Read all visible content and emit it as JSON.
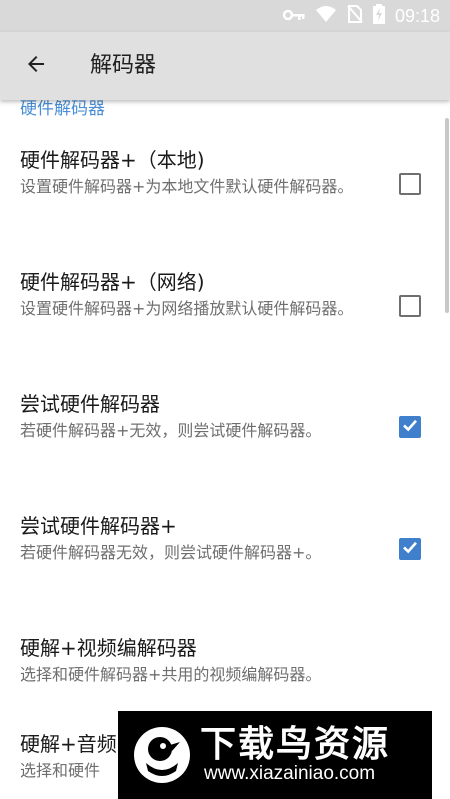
{
  "status_bar": {
    "time": "09:18",
    "icons": [
      "key-icon",
      "wifi-icon",
      "no-sim-icon",
      "battery-charging-icon"
    ]
  },
  "toolbar": {
    "back_icon": "arrow-left-icon",
    "title": "解码器"
  },
  "section": {
    "header": "硬件解码器"
  },
  "preferences": [
    {
      "title": "硬件解码器+（本地)",
      "summary": "设置硬件解码器+为本地文件默认硬件解码器。",
      "checked": false
    },
    {
      "title": "硬件解码器+（网络)",
      "summary": "设置硬件解码器+为网络播放默认硬件解码器。",
      "checked": false
    },
    {
      "title": "尝试硬件解码器",
      "summary": "若硬件解码器+无效，则尝试硬件解码器。",
      "checked": true
    },
    {
      "title": "尝试硬件解码器+",
      "summary": "若硬件解码器无效，则尝试硬件解码器+。",
      "checked": true
    },
    {
      "title": "硬解+视频编解码器",
      "summary": "选择和硬件解码器+共用的视频编解码器。"
    },
    {
      "title": "硬解+音频",
      "summary": "选择和硬件"
    }
  ],
  "watermark": {
    "text": "下载鸟资源",
    "url": "www.xiazainiao.com"
  },
  "colors": {
    "accent": "#3f7fcb",
    "section_header": "#4a8fd6",
    "toolbar": "#e0e0e0",
    "status_bar": "#d9d9d9"
  }
}
